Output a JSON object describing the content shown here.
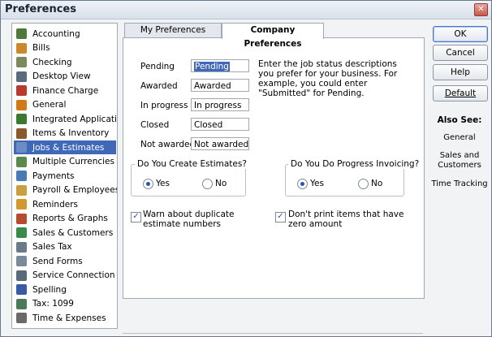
{
  "window": {
    "title": "Preferences",
    "close_glyph": "✕"
  },
  "sidebar": {
    "items": [
      {
        "label": "Accounting",
        "icon": "accounting-icon",
        "color": "#4b7a3a"
      },
      {
        "label": "Bills",
        "icon": "bills-icon",
        "color": "#c9892c"
      },
      {
        "label": "Checking",
        "icon": "checking-icon",
        "color": "#7a8a5a"
      },
      {
        "label": "Desktop View",
        "icon": "desktop-view-icon",
        "color": "#5a6b7e"
      },
      {
        "label": "Finance Charge",
        "icon": "finance-charge-icon",
        "color": "#b83b2e"
      },
      {
        "label": "General",
        "icon": "general-icon",
        "color": "#d07a1a"
      },
      {
        "label": "Integrated Applications",
        "icon": "integrated-applications-icon",
        "color": "#3b7a2e"
      },
      {
        "label": "Items & Inventory",
        "icon": "items-inventory-icon",
        "color": "#8a5a2a"
      },
      {
        "label": "Jobs & Estimates",
        "icon": "jobs-estimates-icon",
        "color": "#6b8cc6",
        "selected": true
      },
      {
        "label": "Multiple Currencies",
        "icon": "multiple-currencies-icon",
        "color": "#5a8a4a"
      },
      {
        "label": "Payments",
        "icon": "payments-icon",
        "color": "#4a7ab5"
      },
      {
        "label": "Payroll & Employees",
        "icon": "payroll-employees-icon",
        "color": "#c8a040"
      },
      {
        "label": "Reminders",
        "icon": "reminders-icon",
        "color": "#d09a30"
      },
      {
        "label": "Reports & Graphs",
        "icon": "reports-graphs-icon",
        "color": "#b84a30"
      },
      {
        "label": "Sales & Customers",
        "icon": "sales-customers-icon",
        "color": "#3a8a4a"
      },
      {
        "label": "Sales Tax",
        "icon": "sales-tax-icon",
        "color": "#6a7a8a"
      },
      {
        "label": "Send Forms",
        "icon": "send-forms-icon",
        "color": "#7a8a9a"
      },
      {
        "label": "Service Connection",
        "icon": "service-connection-icon",
        "color": "#5a6a7a"
      },
      {
        "label": "Spelling",
        "icon": "spelling-icon",
        "color": "#3a5aa8"
      },
      {
        "label": "Tax: 1099",
        "icon": "tax-1099-icon",
        "color": "#4a7a5a"
      },
      {
        "label": "Time & Expenses",
        "icon": "time-expenses-icon",
        "color": "#6a6a6a"
      }
    ]
  },
  "tabs": [
    {
      "label": "My Preferences",
      "active": false
    },
    {
      "label": "Company Preferences",
      "active": true
    }
  ],
  "job_status": {
    "fields": [
      {
        "label": "Pending",
        "value": "Pending",
        "highlighted": true
      },
      {
        "label": "Awarded",
        "value": "Awarded"
      },
      {
        "label": "In progress",
        "value": "In progress"
      },
      {
        "label": "Closed",
        "value": "Closed"
      },
      {
        "label": "Not awarded",
        "value": "Not awarded"
      }
    ],
    "description": "Enter the job status descriptions you prefer for your business.  For example, you could enter \"Submitted\" for Pending."
  },
  "estimates": {
    "legend": "Do You Create Estimates?",
    "yes": "Yes",
    "no": "No",
    "selected": "yes"
  },
  "progress_invoicing": {
    "legend": "Do You Do Progress Invoicing?",
    "yes": "Yes",
    "no": "No",
    "selected": "yes"
  },
  "checkboxes": {
    "warn_duplicate": {
      "label": "Warn about duplicate estimate numbers",
      "checked": true
    },
    "dont_print_zero": {
      "label": "Don't print items that have zero amount",
      "checked": true
    }
  },
  "buttons": {
    "ok": "OK",
    "cancel": "Cancel",
    "help": "Help",
    "default": "Default"
  },
  "also_see": {
    "title": "Also See:",
    "links": [
      "General",
      "Sales and Customers",
      "Time Tracking"
    ]
  }
}
